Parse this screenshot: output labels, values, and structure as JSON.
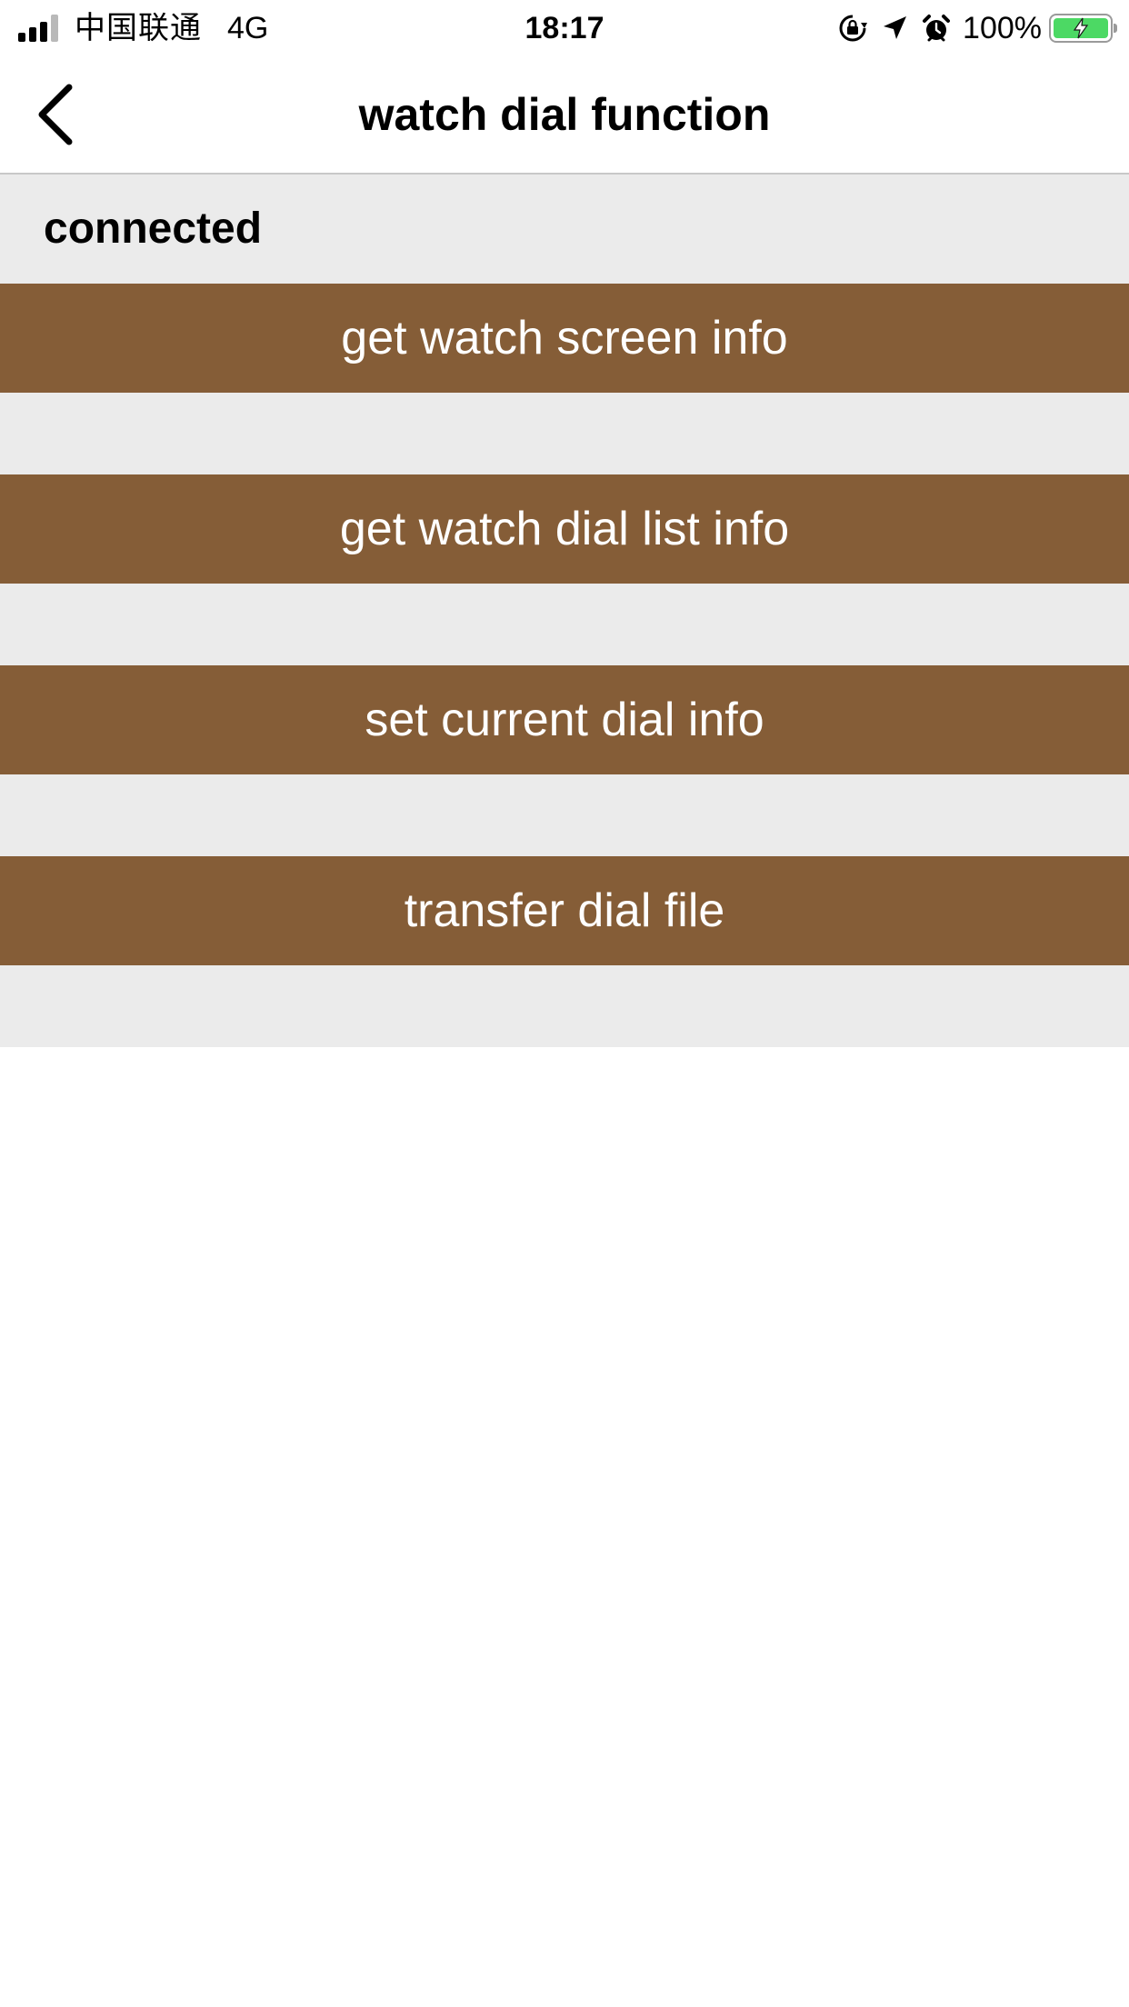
{
  "status_bar": {
    "carrier": "中国联通",
    "network": "4G",
    "time": "18:17",
    "battery_percent": "100%",
    "battery_color": "#4cd964",
    "icons": [
      "orientation-lock-icon",
      "location-arrow-icon",
      "alarm-clock-icon",
      "battery-charging-icon"
    ]
  },
  "nav": {
    "title": "watch dial function",
    "back_icon": "chevron-left-icon"
  },
  "main": {
    "connection_status": "connected",
    "buttons": [
      {
        "label": "get watch screen info"
      },
      {
        "label": "get watch dial list info"
      },
      {
        "label": "set current dial info"
      },
      {
        "label": "transfer dial file"
      }
    ]
  },
  "colors": {
    "button_background": "#855d37",
    "button_text": "#ffffff",
    "content_background": "#ebebeb"
  }
}
